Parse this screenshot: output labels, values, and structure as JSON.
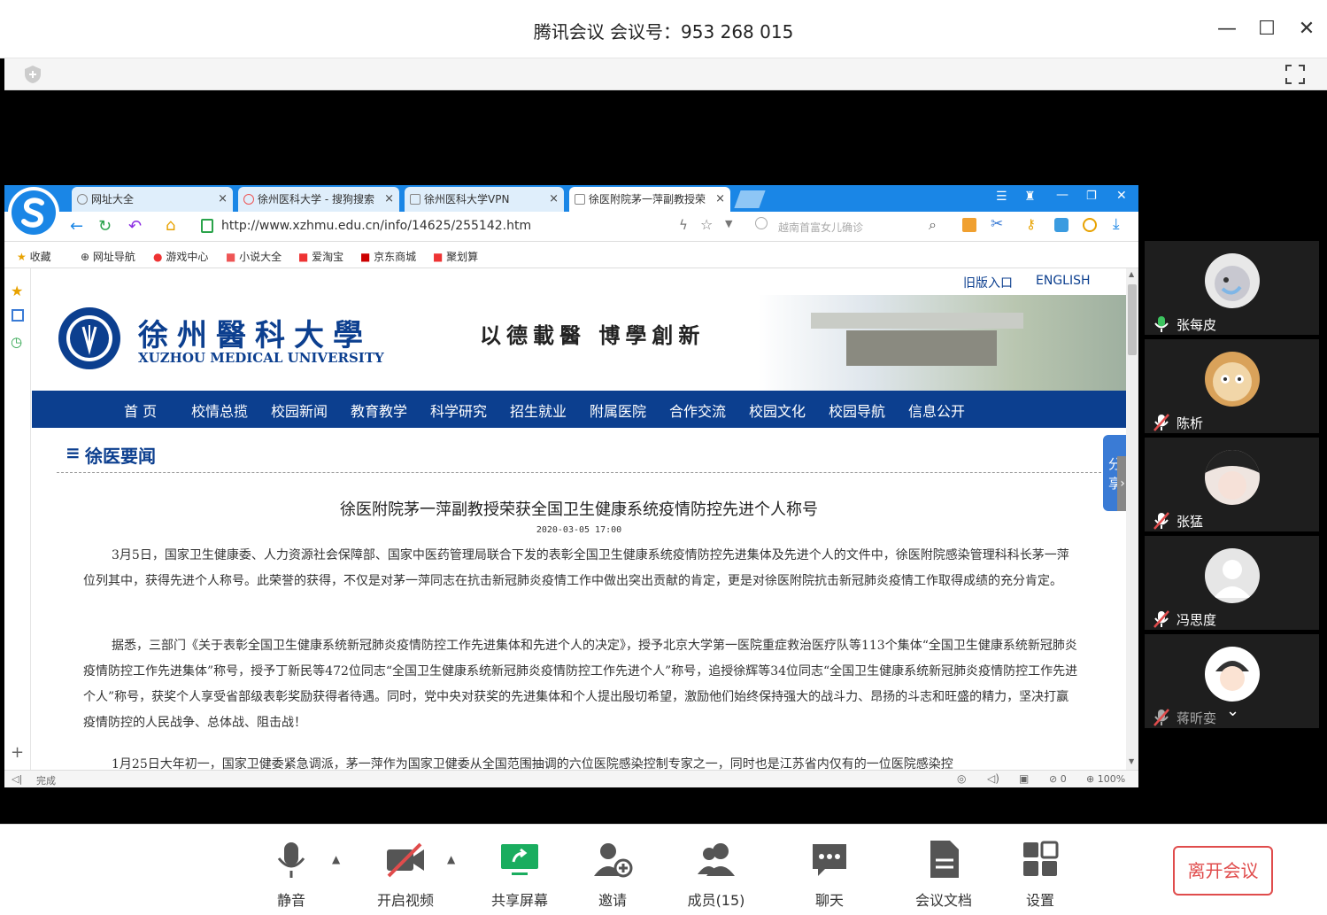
{
  "window": {
    "title": "腾讯会议 会议号：953 268 015",
    "minimize_glyph": "—",
    "maximize_glyph": "☐",
    "close_glyph": "✕"
  },
  "browser": {
    "tabs": [
      {
        "label": "网址大全"
      },
      {
        "label": "徐州医科大学 - 搜狗搜索"
      },
      {
        "label": "徐州医科大学VPN"
      },
      {
        "label": "徐医附院茅一萍副教授荣"
      }
    ],
    "url": "http://www.xzhmu.edu.cn/info/14625/255142.htm",
    "search_placeholder": "越南首富女儿确诊",
    "bookmarks": [
      "收藏",
      "网址导航",
      "游戏中心",
      "小说大全",
      "爱淘宝",
      "京东商城",
      "聚划算"
    ],
    "status_text": "完成",
    "status_blocked": "0",
    "zoom": "100%"
  },
  "site": {
    "top_links": [
      "旧版入口",
      "ENGLISH"
    ],
    "logo_cn": "徐州醫科大學",
    "logo_en": "XUZHOU MEDICAL UNIVERSITY",
    "motto": "以德載醫 博學創新",
    "nav": [
      "首 页",
      "校情总揽",
      "校园新闻",
      "教育教学",
      "科学研究",
      "招生就业",
      "附属医院",
      "合作交流",
      "校园文化",
      "校园导航",
      "信息公开"
    ],
    "section_title": "徐医要闻",
    "share_label": "分享",
    "article": {
      "title": "徐医附院茅一萍副教授荣获全国卫生健康系统疫情防控先进个人称号",
      "date": "2020-03-05 17:00",
      "p1": "3月5日，国家卫生健康委、人力资源社会保障部、国家中医药管理局联合下发的表彰全国卫生健康系统疫情防控先进集体及先进个人的文件中，徐医附院感染管理科科长茅一萍位列其中，获得先进个人称号。此荣誉的获得，不仅是对茅一萍同志在抗击新冠肺炎疫情工作中做出突出贡献的肯定，更是对徐医附院抗击新冠肺炎疫情工作取得成绩的充分肯定。",
      "p2": "据悉，三部门《关于表彰全国卫生健康系统新冠肺炎疫情防控工作先进集体和先进个人的决定》，授予北京大学第一医院重症救治医疗队等113个集体“全国卫生健康系统新冠肺炎疫情防控工作先进集体”称号，授予丁新民等472位同志“全国卫生健康系统新冠肺炎疫情防控工作先进个人”称号，追授徐辉等34位同志“全国卫生健康系统新冠肺炎疫情防控工作先进个人”称号，获奖个人享受省部级表彰奖励获得者待遇。同时，党中央对获奖的先进集体和个人提出殷切希望，激励他们始终保持强大的战斗力、昂扬的斗志和旺盛的精力，坚决打赢疫情防控的人民战争、总体战、阻击战！",
      "p3": "1月25日大年初一，国家卫健委紧急调派，茅一萍作为国家卫健委从全国范围抽调的六位医院感染控制专家之一，同时也是江苏省内仅有的一位医院感染控"
    }
  },
  "participants": [
    {
      "name": "张每皮",
      "muted": false
    },
    {
      "name": "陈析",
      "muted": true
    },
    {
      "name": "张猛",
      "muted": true
    },
    {
      "name": "冯思度",
      "muted": true
    },
    {
      "name": "蒋昕娈",
      "muted": true
    }
  ],
  "toolbar": {
    "mute": "静音",
    "video": "开启视频",
    "share": "共享屏幕",
    "invite": "邀请",
    "members": "成员(15)",
    "chat": "聊天",
    "docs": "会议文档",
    "settings": "设置",
    "leave": "离开会议"
  },
  "colors": {
    "browser_tabstrip": "#1a86e6",
    "site_nav": "#0c3f8f",
    "leave_red": "#e04c4c",
    "share_green": "#1aad5f"
  }
}
